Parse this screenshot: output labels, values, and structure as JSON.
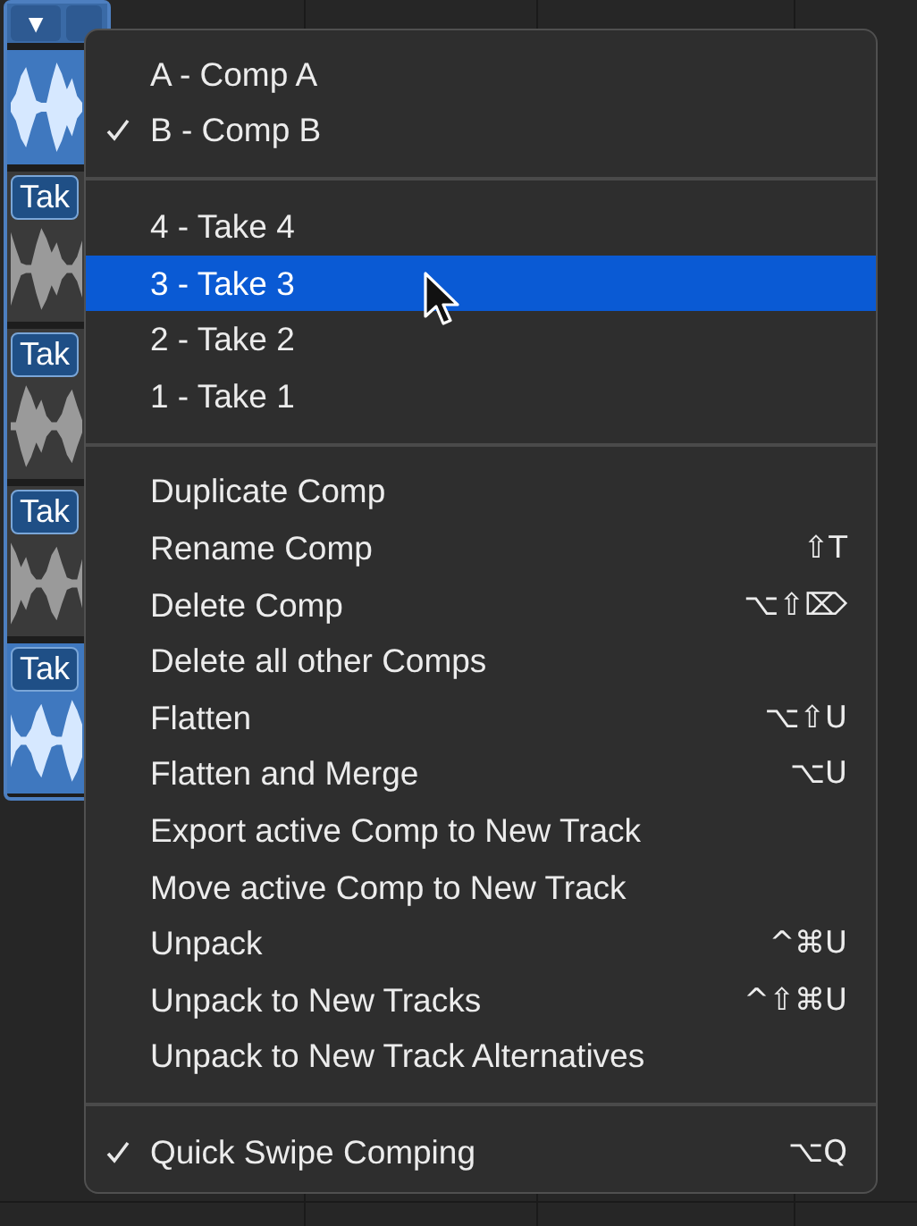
{
  "track_header": {
    "collapse": "▼"
  },
  "lanes": [
    {
      "kind": "comp",
      "selected": true
    },
    {
      "kind": "take",
      "label": "Tak",
      "selected": false
    },
    {
      "kind": "take",
      "label": "Tak",
      "selected": false
    },
    {
      "kind": "take",
      "label": "Tak",
      "selected": false
    },
    {
      "kind": "take",
      "label": "Tak",
      "selected": true
    }
  ],
  "menu": {
    "sections": [
      [
        {
          "label": "A - Comp A",
          "checked": false,
          "selected": false
        },
        {
          "label": "B - Comp B",
          "checked": true,
          "selected": false
        }
      ],
      [
        {
          "label": "4 - Take 4",
          "checked": false,
          "selected": false
        },
        {
          "label": "3 - Take 3",
          "checked": false,
          "selected": true
        },
        {
          "label": "2 - Take 2",
          "checked": false,
          "selected": false
        },
        {
          "label": "1 - Take 1",
          "checked": false,
          "selected": false
        }
      ],
      [
        {
          "label": "Duplicate Comp",
          "checked": false,
          "selected": false
        },
        {
          "label": "Rename Comp",
          "checked": false,
          "selected": false,
          "shortcut": "⇧T"
        },
        {
          "label": "Delete Comp",
          "checked": false,
          "selected": false,
          "shortcut": "⌥⇧⌦"
        },
        {
          "label": "Delete all other Comps",
          "checked": false,
          "selected": false
        },
        {
          "label": "Flatten",
          "checked": false,
          "selected": false,
          "shortcut": "⌥⇧U"
        },
        {
          "label": "Flatten and Merge",
          "checked": false,
          "selected": false,
          "shortcut": "⌥U"
        },
        {
          "label": "Export active Comp to New Track",
          "checked": false,
          "selected": false
        },
        {
          "label": "Move active Comp to New Track",
          "checked": false,
          "selected": false
        },
        {
          "label": "Unpack",
          "checked": false,
          "selected": false,
          "shortcut": "^⌘U"
        },
        {
          "label": "Unpack to New Tracks",
          "checked": false,
          "selected": false,
          "shortcut": "^⇧⌘U"
        },
        {
          "label": "Unpack to New Track Alternatives",
          "checked": false,
          "selected": false
        }
      ],
      [
        {
          "label": "Quick Swipe Comping",
          "checked": true,
          "selected": false,
          "shortcut": "⌥Q"
        }
      ]
    ]
  }
}
